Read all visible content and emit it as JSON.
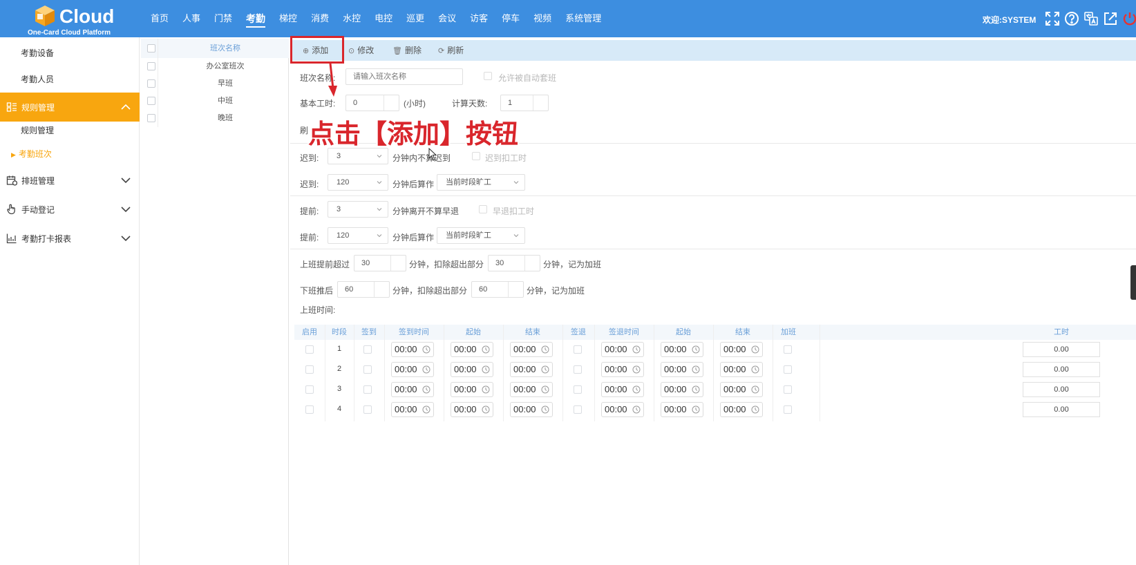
{
  "brand": {
    "name": "Cloud",
    "subtitle": "One-Card Cloud Platform"
  },
  "nav": [
    {
      "label": "首页"
    },
    {
      "label": "人事"
    },
    {
      "label": "门禁"
    },
    {
      "label": "考勤",
      "active": true
    },
    {
      "label": "梯控"
    },
    {
      "label": "消费"
    },
    {
      "label": "水控"
    },
    {
      "label": "电控"
    },
    {
      "label": "巡更"
    },
    {
      "label": "会议"
    },
    {
      "label": "访客"
    },
    {
      "label": "停车"
    },
    {
      "label": "视频"
    },
    {
      "label": "系统管理"
    }
  ],
  "user": {
    "welcome": "欢迎:SYSTEM"
  },
  "sidebar": {
    "items": [
      {
        "label": "考勤设备"
      },
      {
        "label": "考勤人员"
      },
      {
        "label": "规则管理"
      },
      {
        "label": "规则管理"
      },
      {
        "label": "考勤班次"
      },
      {
        "label": "排班管理"
      },
      {
        "label": "手动登记"
      },
      {
        "label": "考勤打卡报表"
      }
    ]
  },
  "shift_list": {
    "header": "班次名称",
    "rows": [
      "办公室班次",
      "早班",
      "中班",
      "晚班"
    ]
  },
  "toolbar": {
    "add": "添加",
    "edit": "修改",
    "delete": "删除",
    "refresh": "刷新"
  },
  "form": {
    "shift_name_label": "班次名称:",
    "shift_name_placeholder": "请输入班次名称",
    "auto_match_label": "允许被自动套班",
    "base_hours_label": "基本工时:",
    "base_hours_value": "0",
    "hours_unit": "(小时)",
    "calc_days_label": "计算天数:",
    "calc_days_value": "1",
    "brush_label": "刷",
    "late1_label": "迟到:",
    "late1_value": "3",
    "late1_text": "分钟内不算迟到",
    "late_deduct_label": "迟到扣工时",
    "late2_label": "迟到:",
    "late2_value": "120",
    "late2_text": "分钟后算作",
    "late2_select": "当前时段旷工",
    "early1_label": "提前:",
    "early1_value": "3",
    "early1_text": "分钟离开不算早退",
    "early_deduct_label": "早退扣工时",
    "early2_label": "提前:",
    "early2_value": "120",
    "early2_text": "分钟后算作",
    "early2_select": "当前时段旷工",
    "ot_before_label": "上班提前超过",
    "ot_before_value": "30",
    "ot_before_mid": "分钟，扣除超出部分",
    "ot_before_value2": "30",
    "ot_before_end": "分钟，记为加班",
    "ot_after_label": "下班推后",
    "ot_after_value": "60",
    "ot_after_mid": "分钟，扣除超出部分",
    "ot_after_value2": "60",
    "ot_after_end": "分钟，记为加班",
    "work_time_label": "上班时间:"
  },
  "table": {
    "headers": [
      "启用",
      "时段",
      "签到",
      "签到时间",
      "起始",
      "结束",
      "签退",
      "签退时间",
      "起始",
      "结束",
      "加班",
      "工时"
    ],
    "rows": [
      {
        "seg": "1",
        "t1": "00:00",
        "t2": "00:00",
        "t3": "00:00",
        "t4": "00:00",
        "t5": "00:00",
        "t6": "00:00",
        "hours": "0.00"
      },
      {
        "seg": "2",
        "t1": "00:00",
        "t2": "00:00",
        "t3": "00:00",
        "t4": "00:00",
        "t5": "00:00",
        "t6": "00:00",
        "hours": "0.00"
      },
      {
        "seg": "3",
        "t1": "00:00",
        "t2": "00:00",
        "t3": "00:00",
        "t4": "00:00",
        "t5": "00:00",
        "t6": "00:00",
        "hours": "0.00"
      },
      {
        "seg": "4",
        "t1": "00:00",
        "t2": "00:00",
        "t3": "00:00",
        "t4": "00:00",
        "t5": "00:00",
        "t6": "00:00",
        "hours": "0.00"
      }
    ]
  },
  "annotation": {
    "text": "点击【添加】按钮"
  },
  "colors": {
    "topbar": "#3d8ee0",
    "active_side": "#f8a60f",
    "annotation": "#d9262c",
    "toolbar": "#d7eaf8"
  }
}
